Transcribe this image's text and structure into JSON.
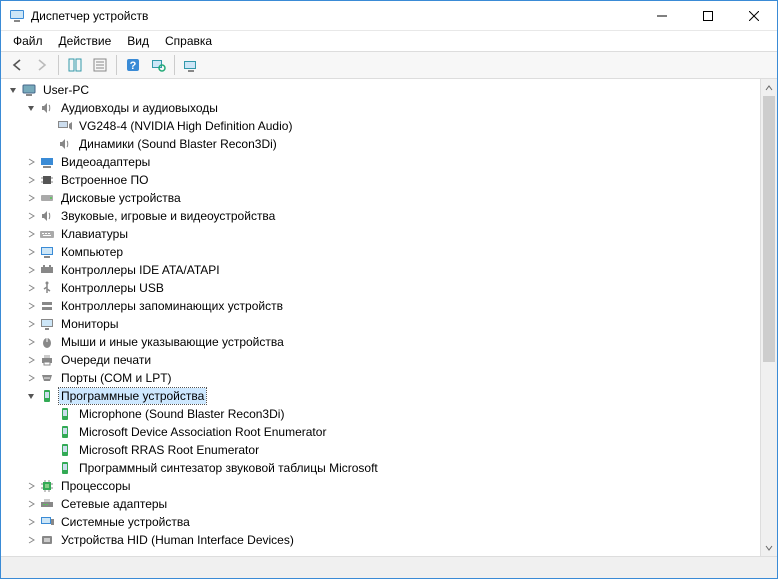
{
  "window": {
    "title": "Диспетчер устройств"
  },
  "menu": {
    "file": "Файл",
    "action": "Действие",
    "view": "Вид",
    "help": "Справка"
  },
  "tree": {
    "root": "User-PC",
    "audio": {
      "label": "Аудиовходы и аудиовыходы",
      "vg248": "VG248-4 (NVIDIA High Definition Audio)",
      "speakers": "Динамики (Sound Blaster Recon3Di)"
    },
    "video": "Видеоадаптеры",
    "firmware": "Встроенное ПО",
    "disk": "Дисковые устройства",
    "soundgame": "Звуковые, игровые и видеоустройства",
    "keyboards": "Клавиатуры",
    "computer": "Компьютер",
    "ide": "Контроллеры IDE ATA/ATAPI",
    "usb": "Контроллеры USB",
    "storage": "Контроллеры запоминающих устройств",
    "monitors": "Мониторы",
    "mice": "Мыши и иные указывающие устройства",
    "printq": "Очереди печати",
    "ports": "Порты (COM и LPT)",
    "software": {
      "label": "Программные устройства",
      "mic": "Microphone (Sound Blaster Recon3Di)",
      "msdare": "Microsoft Device Association Root Enumerator",
      "rras": "Microsoft RRAS Root Enumerator",
      "synth": "Программный синтезатор звуковой таблицы Microsoft"
    },
    "cpu": "Процессоры",
    "net": "Сетевые адаптеры",
    "system": "Системные устройства",
    "hid": "Устройства HID (Human Interface Devices)"
  }
}
